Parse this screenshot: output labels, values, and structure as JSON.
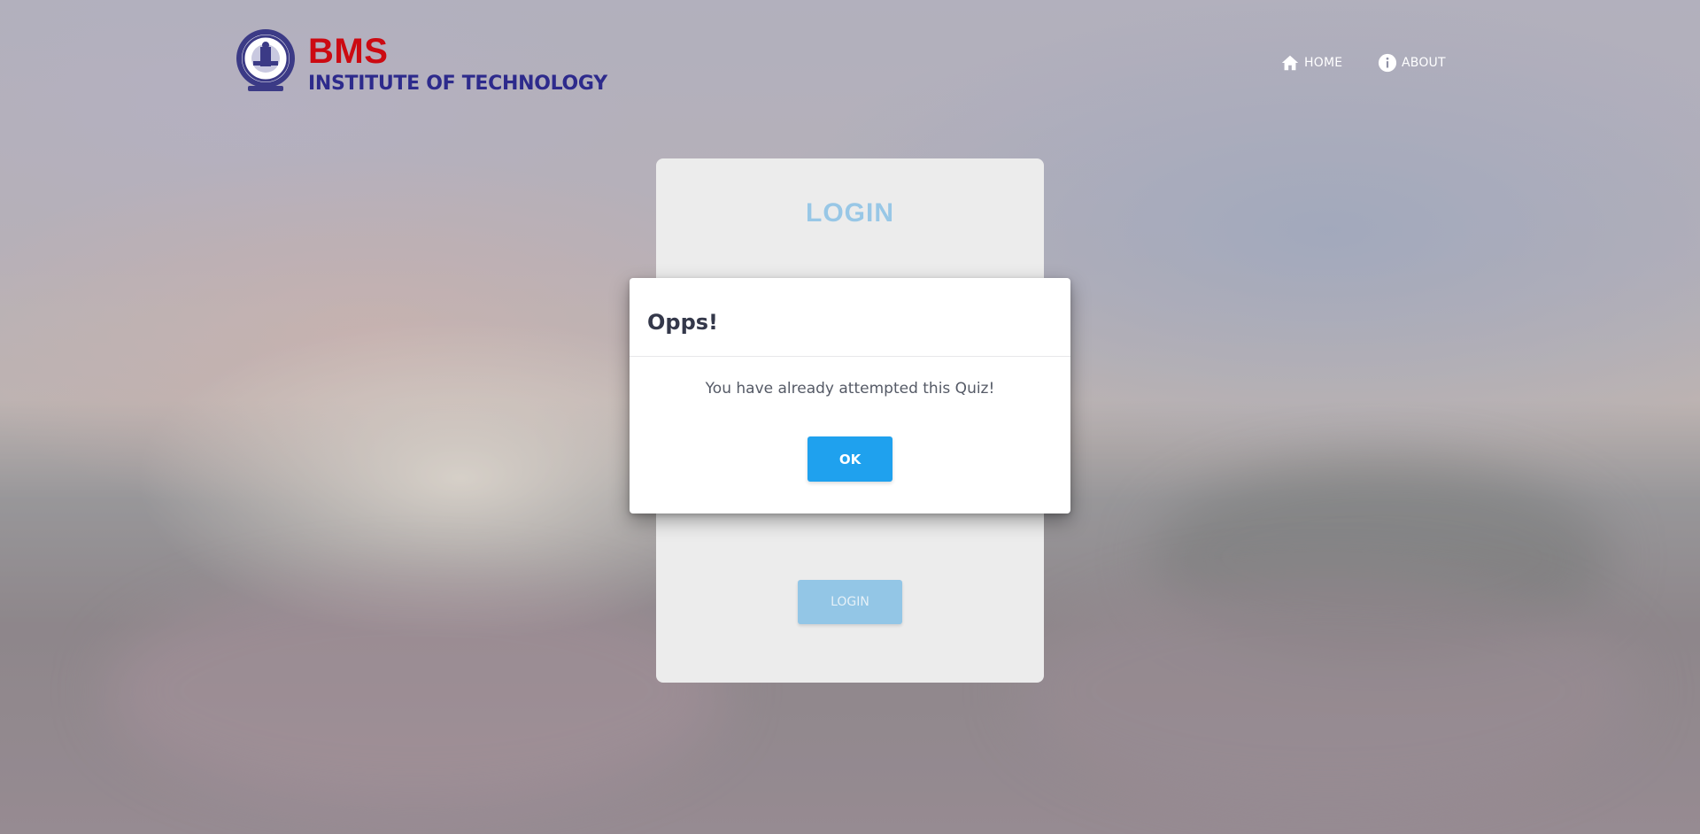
{
  "header": {
    "brand_name": "BMS",
    "brand_subtitle": "INSTITUTE OF TECHNOLOGY",
    "logo_icon": "college-seal-icon",
    "nav": [
      {
        "label": "HOME",
        "icon": "home-icon"
      },
      {
        "label": "ABOUT",
        "icon": "info-icon"
      }
    ]
  },
  "login_card": {
    "title": "LOGIN",
    "button_label": "LOGIN"
  },
  "modal": {
    "title": "Opps!",
    "message": "You have already attempted this Quiz!",
    "ok_label": "OK"
  },
  "colors": {
    "brand_red": "#cc0a12",
    "brand_blue": "#2d2a8c",
    "ok_button": "#1fa1ee",
    "login_title": "#98c7e6",
    "login_button": "#93c6e6"
  }
}
